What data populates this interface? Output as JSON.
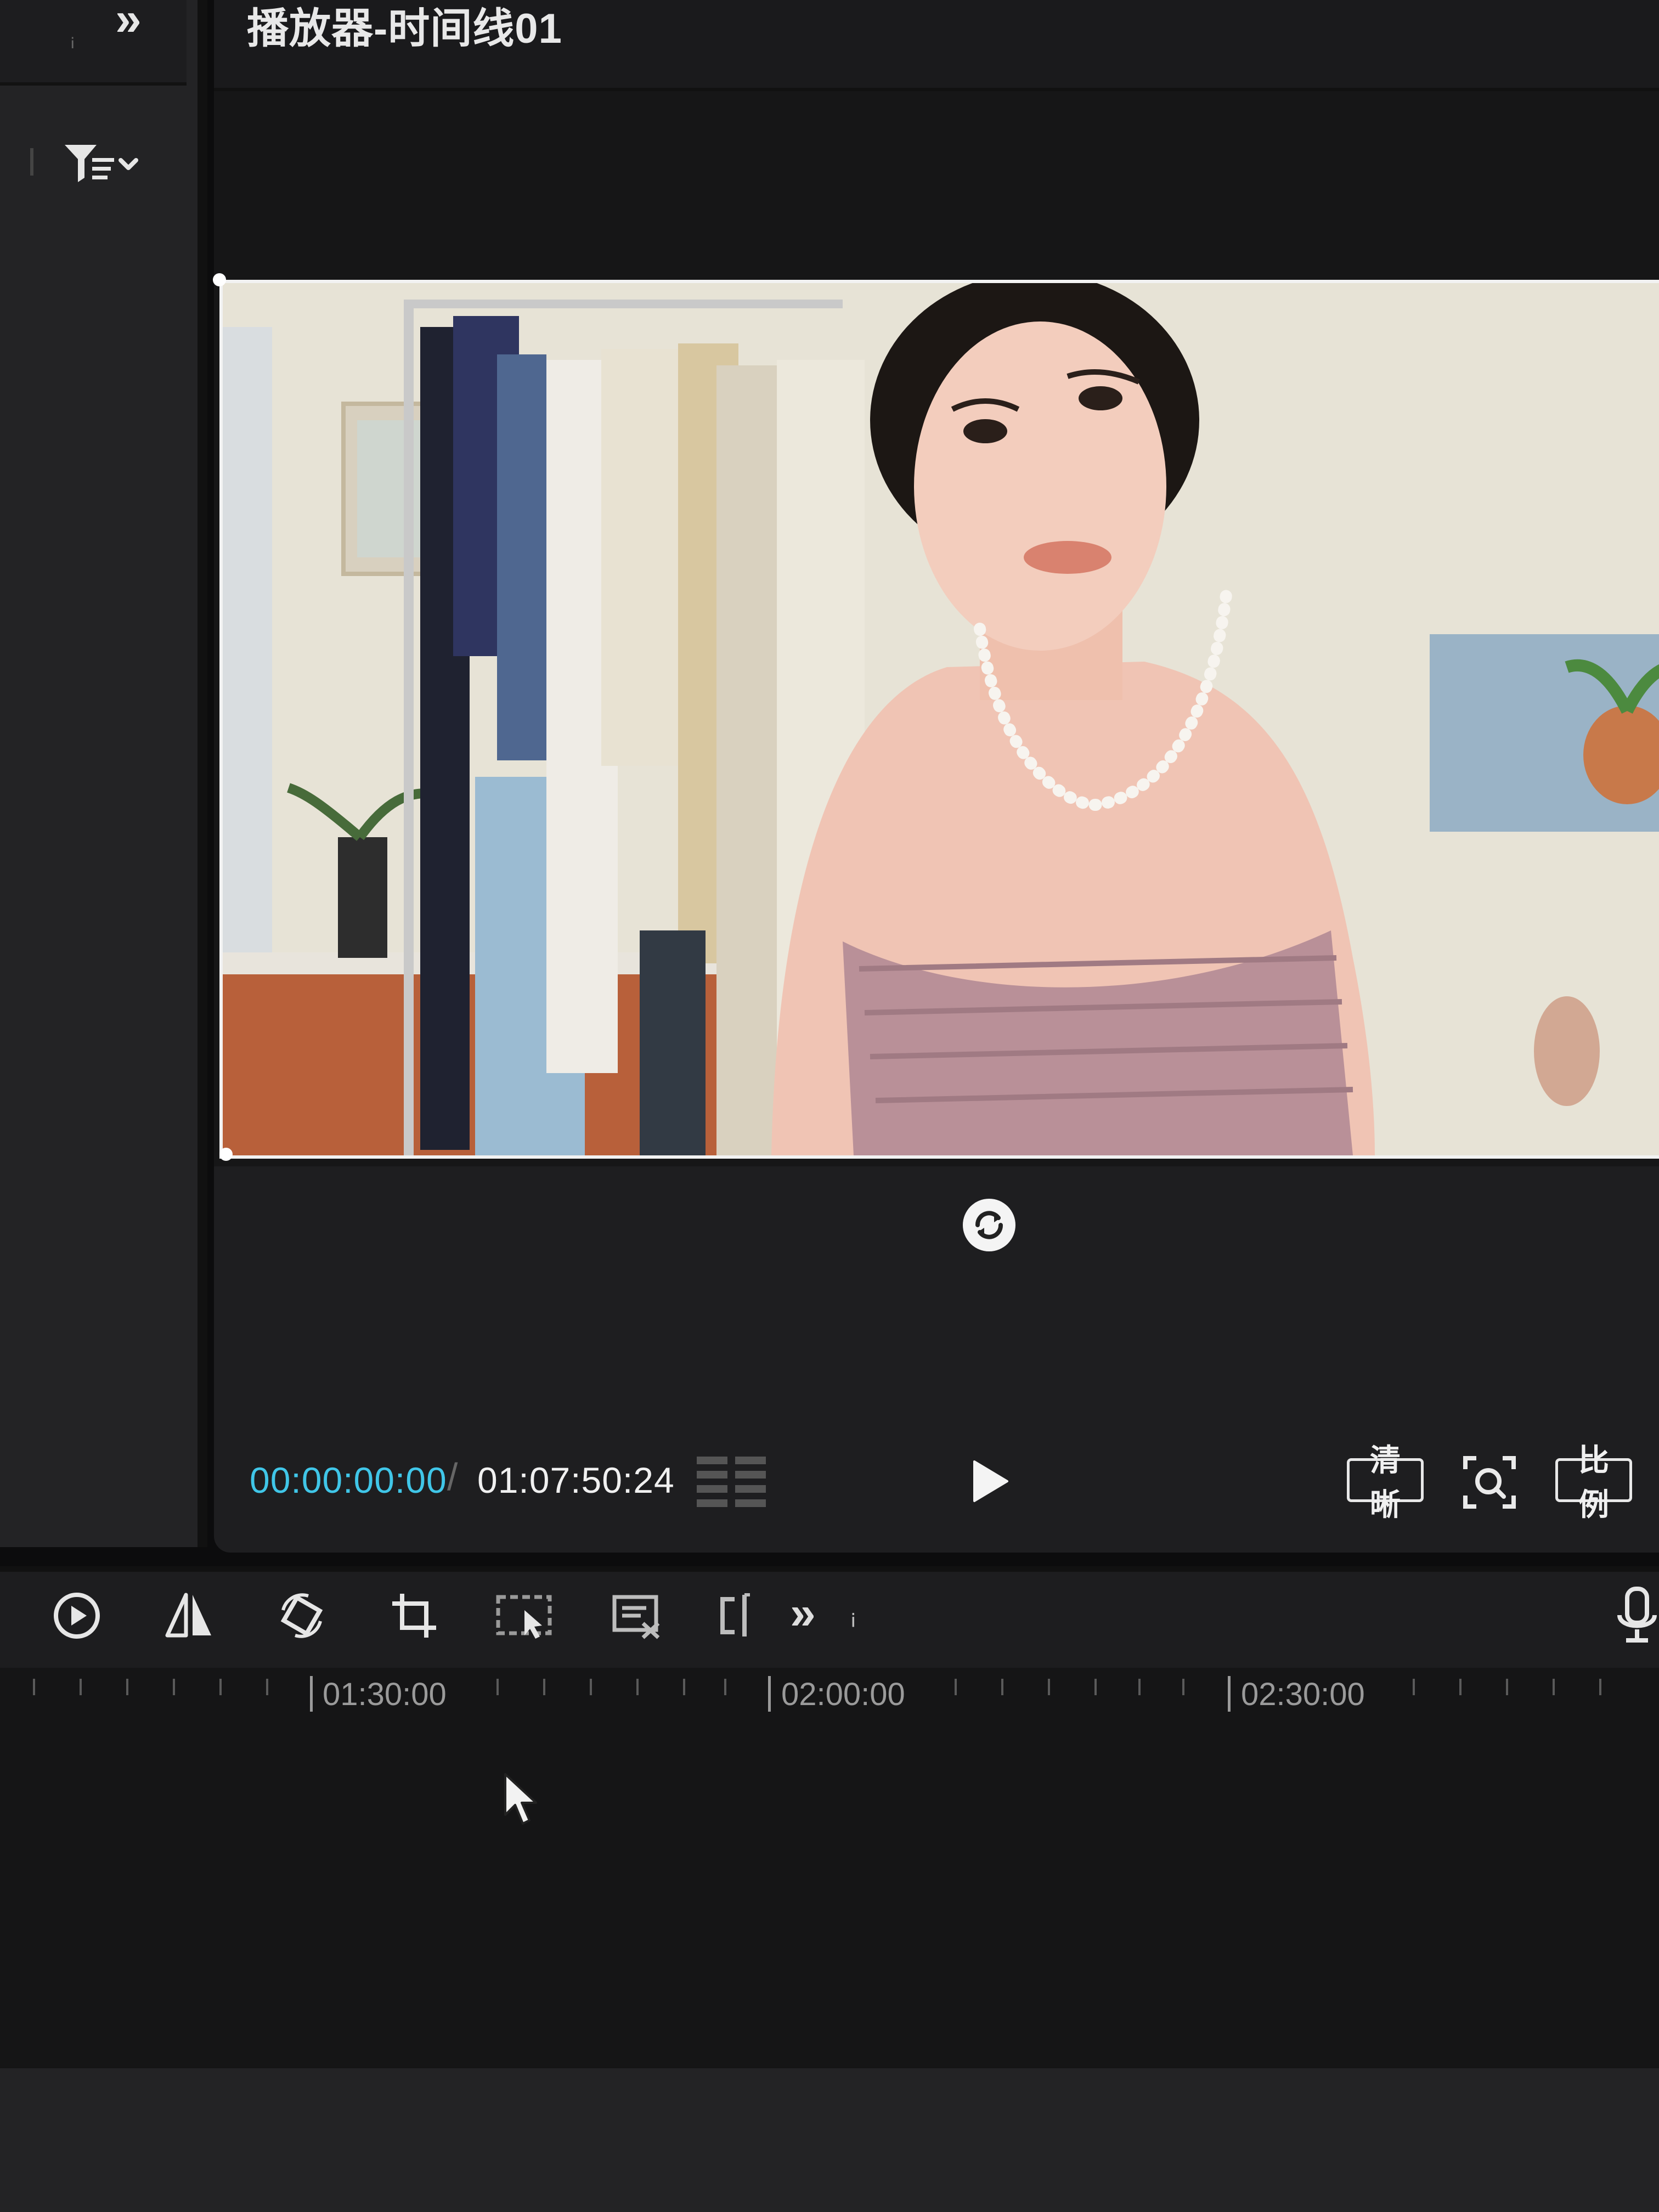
{
  "left_panel": {
    "expand_icon": "double-chevron-right-icon",
    "filter_icon": "filter-sort-icon"
  },
  "player": {
    "title": "播放器-时间线01",
    "timecode_current": "00:00:00:00",
    "timecode_separator": "/",
    "timecode_total": "01:07:50:24",
    "quality_label": "清晰",
    "ratio_label": "比例",
    "accent_color": "#40c6e8"
  },
  "toolbar": {
    "tools": [
      {
        "name": "play-from-start-icon"
      },
      {
        "name": "mirror-icon"
      },
      {
        "name": "rotate-icon"
      },
      {
        "name": "crop-icon"
      },
      {
        "name": "select-area-icon"
      },
      {
        "name": "subtitle-edit-icon"
      },
      {
        "name": "split-icon"
      }
    ],
    "more_label": "»"
  },
  "timeline": {
    "ruler_labels": [
      "01:30:00",
      "02:00:00",
      "02:30:00"
    ]
  }
}
